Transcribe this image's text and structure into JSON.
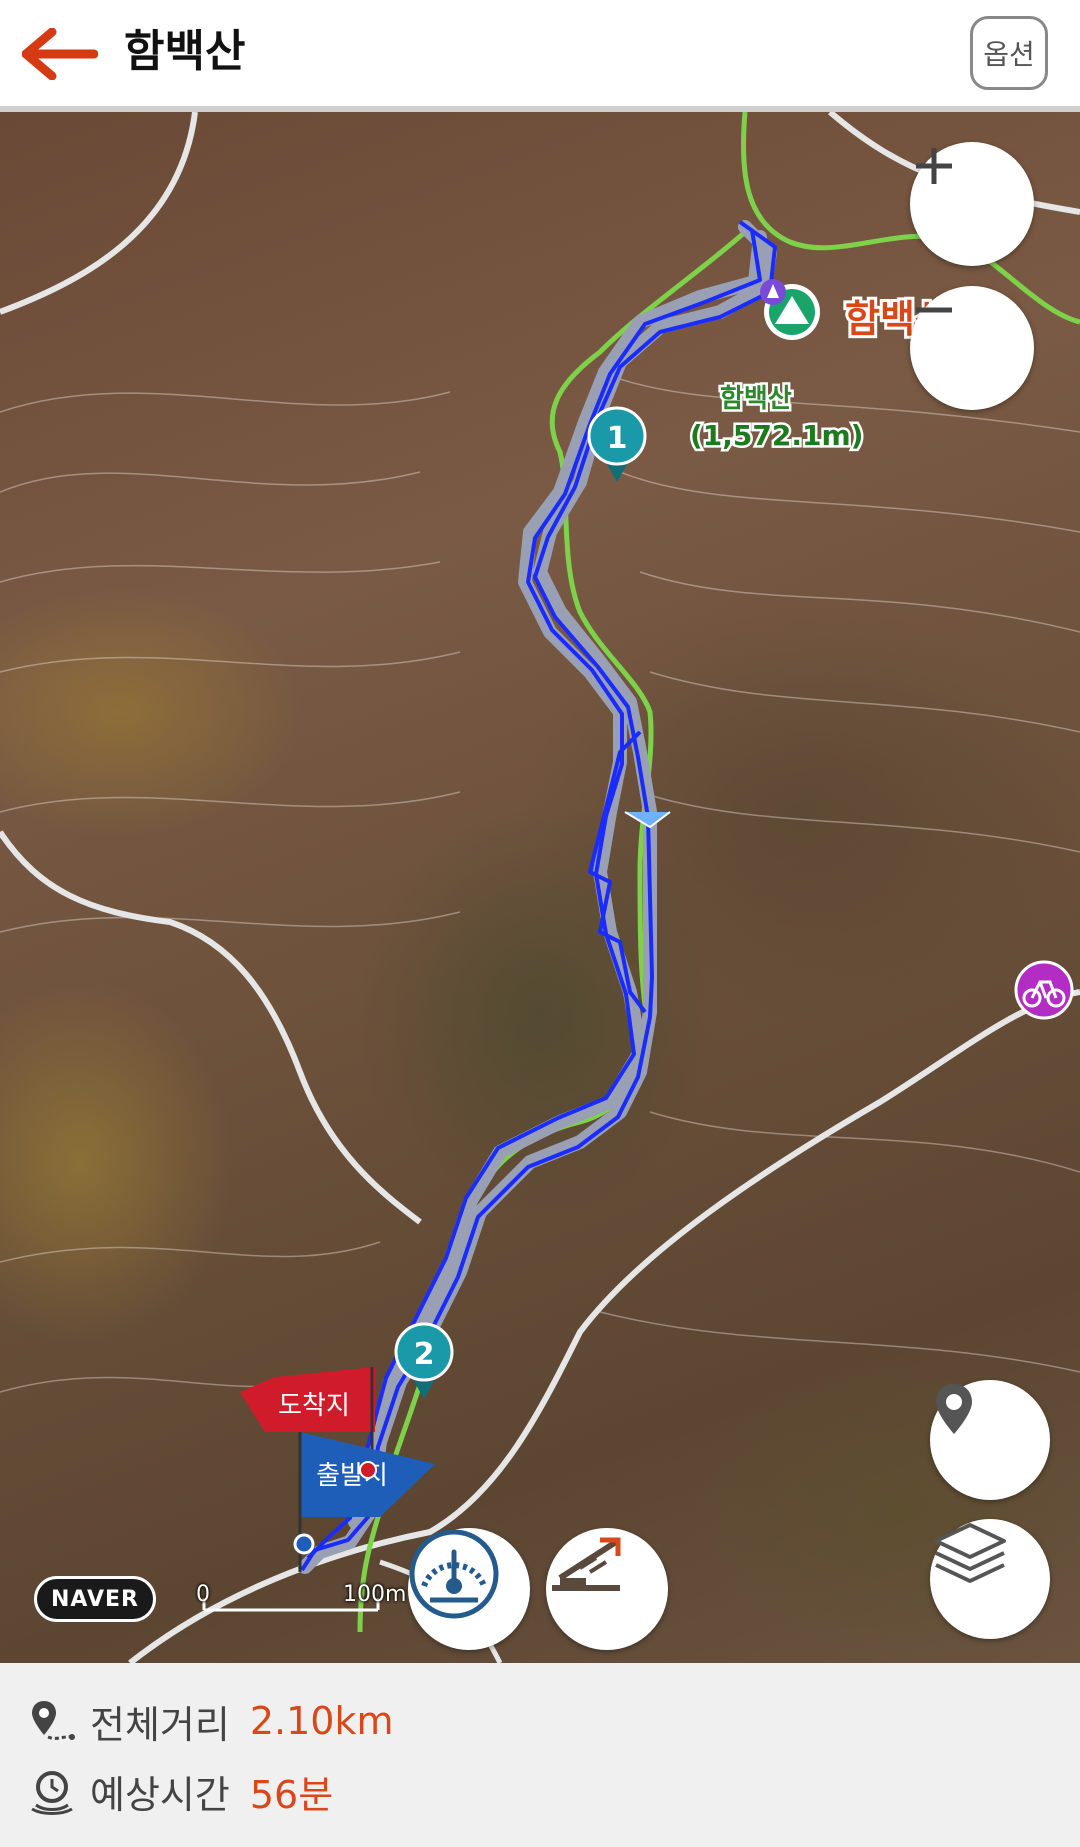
{
  "header": {
    "title": "함백산",
    "options_label": "옵션"
  },
  "map": {
    "summit_label": "함백산",
    "peak_label_name": "함백산",
    "peak_label_elev": "(1,572.1m)",
    "waypoints": [
      "1",
      "2"
    ],
    "arrival_label": "도착지",
    "departure_label": "출발지",
    "provider_badge": "NAVER",
    "scale": {
      "start": "0",
      "end": "100m"
    },
    "route_color": "#1a2bff",
    "trail_color": "#7ed24a"
  },
  "summary": {
    "distance_label": "전체거리",
    "distance_value": "2.10km",
    "time_label": "예상시간",
    "time_value": "56분"
  },
  "colors": {
    "accent": "#d9481a",
    "waypoint": "#1a9aa8",
    "arrival_flag": "#d01c2a",
    "departure_flag": "#1f5eb8"
  }
}
